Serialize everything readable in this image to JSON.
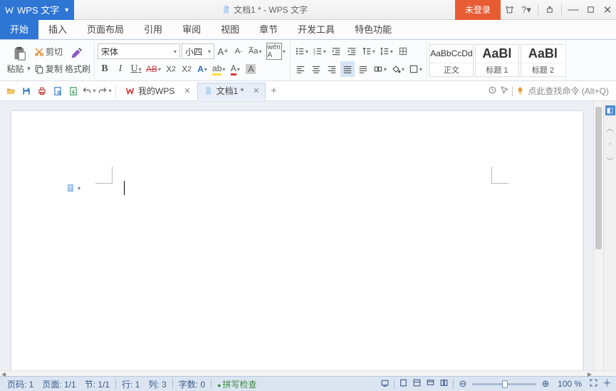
{
  "app": {
    "name": "WPS 文字",
    "doc_title": "文档1 * - WPS 文字",
    "login": "未登录"
  },
  "menu": {
    "tabs": [
      "开始",
      "插入",
      "页面布局",
      "引用",
      "审阅",
      "视图",
      "章节",
      "开发工具",
      "特色功能"
    ],
    "active": 0
  },
  "clipboard": {
    "cut": "剪切",
    "copy": "复制",
    "painter": "格式刷",
    "paste": "粘贴"
  },
  "font": {
    "name": "宋体",
    "size": "小四"
  },
  "styles": [
    {
      "preview": "AaBbCcDd",
      "label": "正文",
      "big": false
    },
    {
      "preview": "AaBl",
      "label": "标题 1",
      "big": true
    },
    {
      "preview": "AaBl",
      "label": "标题 2",
      "big": true
    }
  ],
  "doctabs": {
    "mywps": "我的WPS",
    "doc1": "文档1 *"
  },
  "search": {
    "hint": "点此查找命令 (Alt+Q)"
  },
  "status": {
    "page_no": "页码: 1",
    "page_of": "页面: 1/1",
    "section": "节: 1/1",
    "line": "行: 1",
    "col": "列: 3",
    "words": "字数: 0",
    "spell": "拼写检查",
    "zoom": "100 %"
  }
}
